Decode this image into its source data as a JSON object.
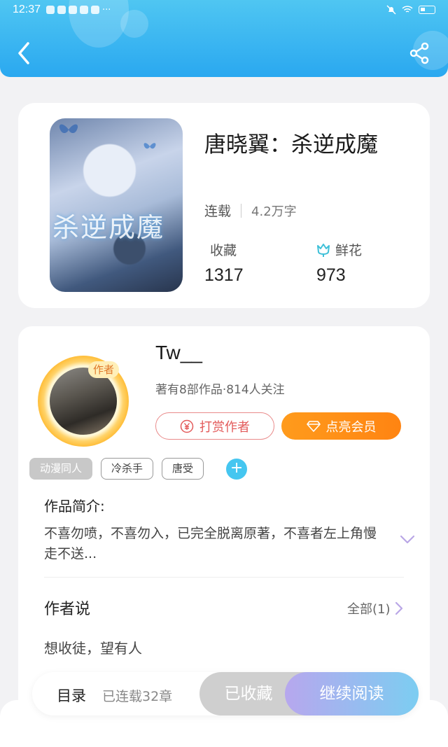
{
  "status_bar": {
    "time": "12:37",
    "dots": "···"
  },
  "book": {
    "cover_text": "杀逆成魔",
    "title": "唐晓翼：杀逆成魔",
    "status": "连载",
    "words": "4.2万字",
    "collect_label": "收藏",
    "collect_count": "1317",
    "flower_label": "鲜花",
    "flower_count": "973"
  },
  "author": {
    "badge": "作者",
    "name": "Tw__",
    "meta": "著有8部作品·814人关注",
    "tip_label": "打赏作者",
    "vip_label": "点亮会员",
    "tags": [
      "动漫同人",
      "冷杀手",
      "唐受"
    ],
    "add_tag": "+",
    "intro_title": "作品简介:",
    "intro_text": "不喜勿喷，不喜勿入，已完全脱离原著，不喜者左上角慢走不送...",
    "say_title": "作者说",
    "say_all": "全部(1)",
    "say_text": "想收徒，望有人"
  },
  "bottom": {
    "toc_label": "目录",
    "chapters": "已连载32章",
    "collected_label": "已收藏",
    "continue_label": "继续阅读"
  },
  "colors": {
    "header": "#2aa8f0",
    "vip": "#ff8c18",
    "tip": "#e35b5b",
    "add_tag": "#45c6f0"
  }
}
